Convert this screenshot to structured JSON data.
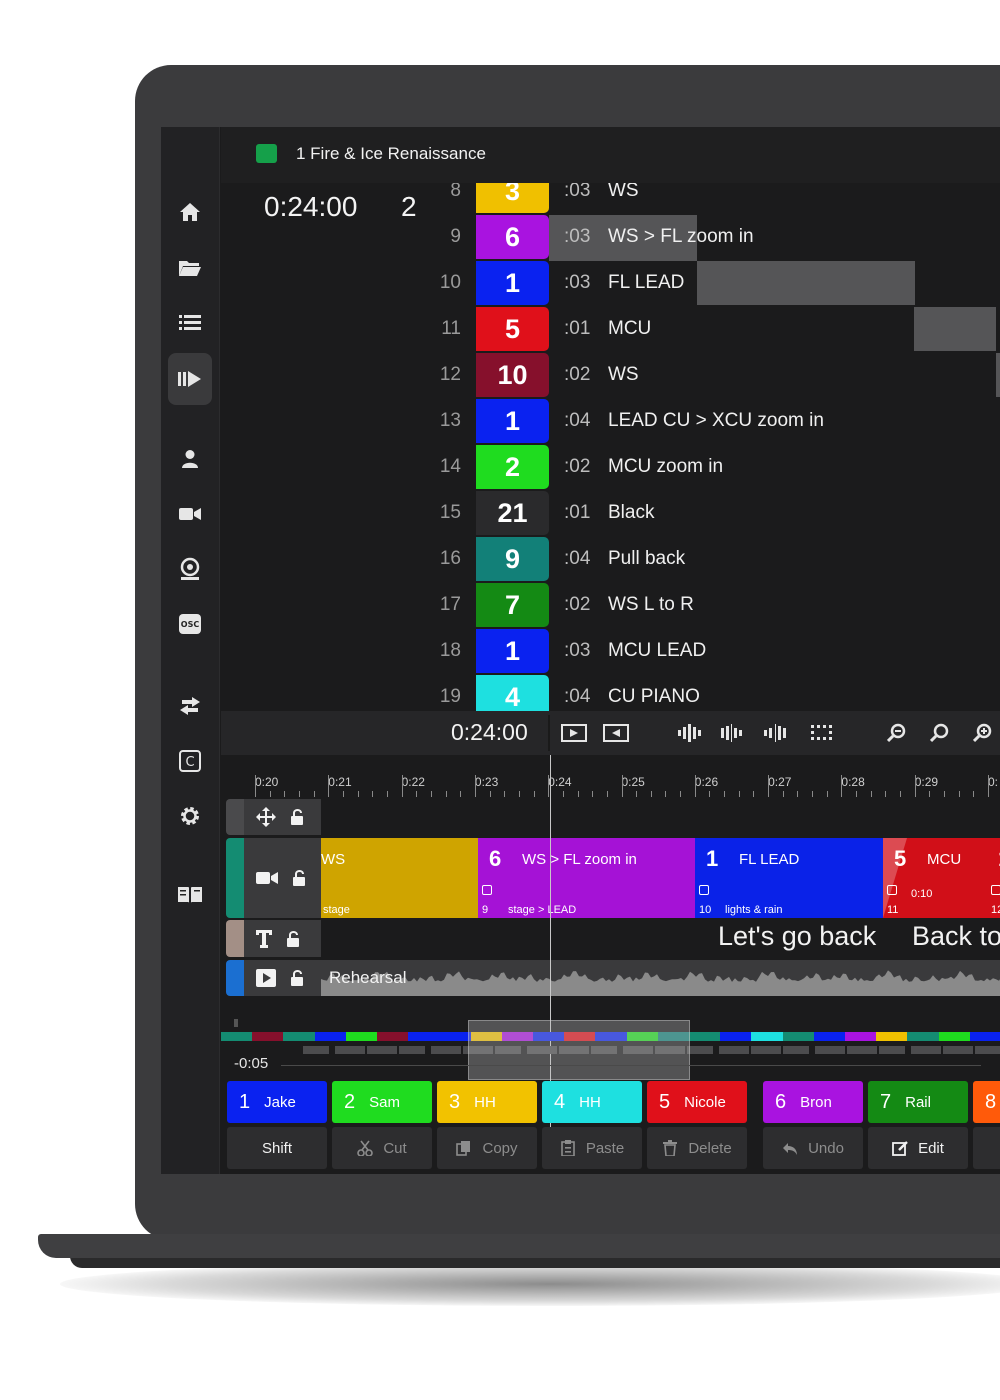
{
  "header": {
    "title": "1  Fire & Ice  Renaissance",
    "color": "#15a04a"
  },
  "status": {
    "time": "0:24:00",
    "shot_number": "2"
  },
  "sidebar": [
    {
      "icon": "home-icon"
    },
    {
      "icon": "folder-icon"
    },
    {
      "icon": "list-icon"
    },
    {
      "icon": "play-shots-icon"
    },
    {
      "icon": "person-icon"
    },
    {
      "icon": "camera-icon"
    },
    {
      "icon": "webcam-icon"
    },
    {
      "icon": "osc-icon",
      "label": "OSC"
    },
    {
      "icon": "swap-icon"
    },
    {
      "icon": "cue-icon",
      "label": "C"
    },
    {
      "icon": "gear-icon"
    },
    {
      "icon": "book-icon"
    }
  ],
  "shots": [
    {
      "num": "8",
      "cam": "3",
      "color": "#f0c000",
      "dur": ":03",
      "desc": "WS"
    },
    {
      "num": "9",
      "cam": "6",
      "color": "#a913e0",
      "dur": ":03",
      "desc": "WS > FL zoom in"
    },
    {
      "num": "10",
      "cam": "1",
      "color": "#0a22f0",
      "dur": ":03",
      "desc": "FL LEAD"
    },
    {
      "num": "11",
      "cam": "5",
      "color": "#e0101a",
      "dur": ":01",
      "desc": "MCU"
    },
    {
      "num": "12",
      "cam": "10",
      "color": "#86102c",
      "dur": ":02",
      "desc": "WS"
    },
    {
      "num": "13",
      "cam": "1",
      "color": "#0a22f0",
      "dur": ":04",
      "desc": "LEAD CU > XCU zoom in"
    },
    {
      "num": "14",
      "cam": "2",
      "color": "#1fdc1f",
      "dur": ":02",
      "desc": "MCU zoom in"
    },
    {
      "num": "15",
      "cam": "21",
      "color": "#2a2a2c",
      "dur": ":01",
      "desc": "Black"
    },
    {
      "num": "16",
      "cam": "9",
      "color": "#128078",
      "dur": ":04",
      "desc": "Pull back"
    },
    {
      "num": "17",
      "cam": "7",
      "color": "#148a14",
      "dur": ":02",
      "desc": "WS L to R"
    },
    {
      "num": "18",
      "cam": "1",
      "color": "#0a22f0",
      "dur": ":03",
      "desc": "MCU LEAD"
    },
    {
      "num": "19",
      "cam": "4",
      "color": "#1ee0e0",
      "dur": ":04",
      "desc": "CU PIANO"
    }
  ],
  "transport": {
    "timecode": "0:24:00",
    "icons": [
      "play-in-icon",
      "play-out-icon",
      "waveform-a-icon",
      "waveform-b-icon",
      "waveform-c-icon",
      "dots-grid-icon",
      "zoom-out-icon",
      "zoom-fit-icon",
      "zoom-in-icon"
    ]
  },
  "ruler": {
    "labels": [
      "0:20",
      "0:21",
      "0:22",
      "0:23",
      "0:24",
      "0:25",
      "0:26",
      "0:27",
      "0:28",
      "0:29",
      "0:"
    ]
  },
  "timeline": {
    "camera_clips": [
      {
        "num": "",
        "label": "WS",
        "sub": "stage",
        "idx": "",
        "color": "#cfa400"
      },
      {
        "num": "6",
        "label": "WS > FL zoom in",
        "sub": "stage > LEAD",
        "idx": "9",
        "color": "#a512d6"
      },
      {
        "num": "1",
        "label": "FL LEAD",
        "sub": "lights & rain",
        "idx": "10",
        "color": "#0a22e8"
      },
      {
        "num": "5",
        "label": "MCU",
        "sub": "0:10",
        "idx": "11",
        "color": "#d10f18"
      },
      {
        "num": "1",
        "label": "",
        "sub": "",
        "idx": "12",
        "color": "#d10f18"
      }
    ],
    "text_track": [
      "Let's go back",
      "Back to"
    ],
    "media_track": {
      "label": "Rehearsal"
    },
    "track_colors": {
      "move": "#4a4a4c",
      "camera": "#148c72",
      "text": "#a38f86",
      "media": "#1b6fd1"
    }
  },
  "overview": {
    "offset": "-0:05"
  },
  "presets": [
    {
      "num": "1",
      "label": "Jake",
      "color": "#0a22f0"
    },
    {
      "num": "2",
      "label": "Sam",
      "color": "#1fdc1f"
    },
    {
      "num": "3",
      "label": "HH",
      "color": "#f2c200"
    },
    {
      "num": "4",
      "label": "HH",
      "color": "#1ee0e0"
    },
    {
      "num": "5",
      "label": "Nicole",
      "color": "#e0101a"
    },
    {
      "num": "6",
      "label": "Bron",
      "color": "#a913e0"
    },
    {
      "num": "7",
      "label": "Rail",
      "color": "#148a14"
    },
    {
      "num": "8",
      "label": "",
      "color": "#ff5a0a"
    }
  ],
  "edit_buttons": [
    {
      "label": "Shift",
      "icon": "",
      "active": true
    },
    {
      "label": "Cut",
      "icon": "scissors-icon",
      "active": false
    },
    {
      "label": "Copy",
      "icon": "copy-icon",
      "active": false
    },
    {
      "label": "Paste",
      "icon": "paste-icon",
      "active": false
    },
    {
      "label": "Delete",
      "icon": "trash-icon",
      "active": false
    },
    {
      "label": "Undo",
      "icon": "undo-icon",
      "active": false
    },
    {
      "label": "Edit",
      "icon": "edit-icon",
      "active": true
    },
    {
      "label": "",
      "icon": "split-icon",
      "active": true
    }
  ]
}
